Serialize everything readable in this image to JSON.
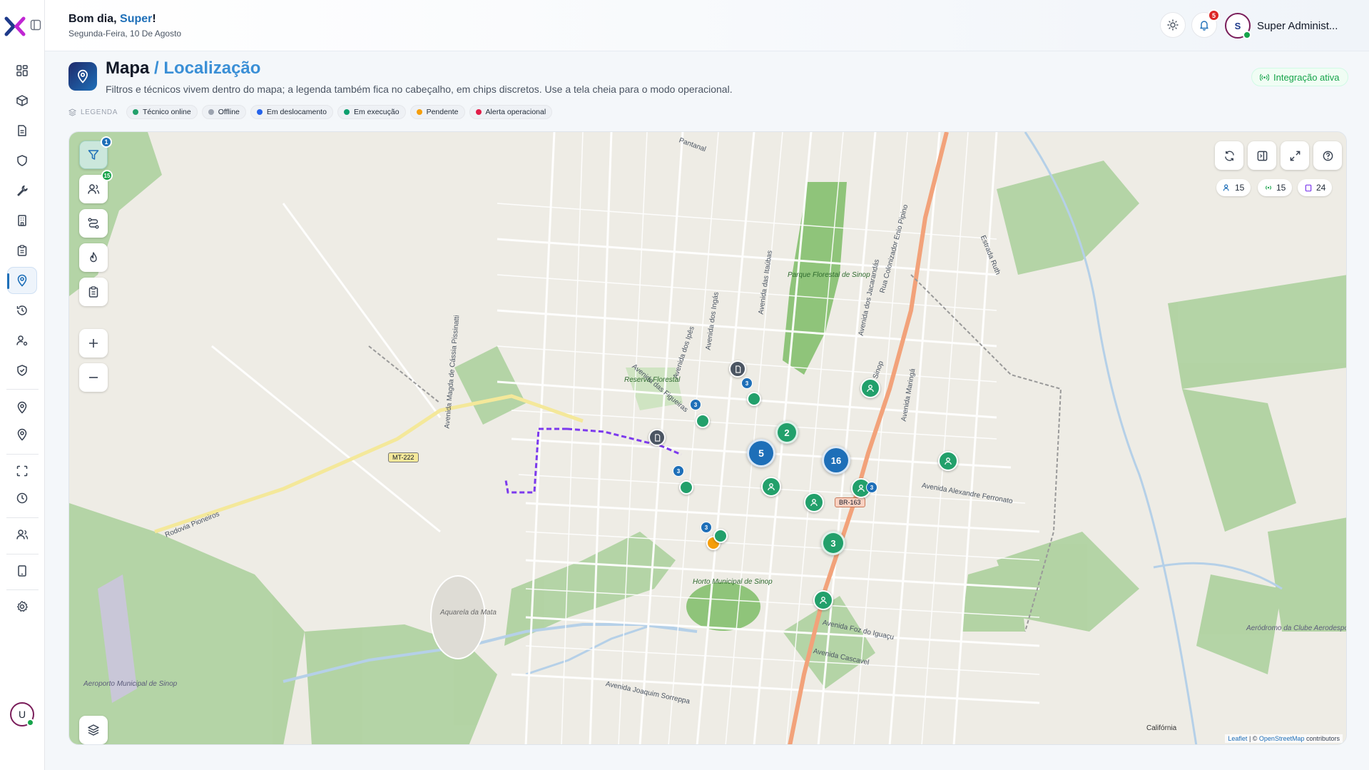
{
  "header": {
    "greeting_prefix": "Bom dia, ",
    "greeting_name": "Super",
    "greeting_suffix": "!",
    "date": "Segunda-Feira, 10 De Agosto",
    "notification_count": "5",
    "user_initial": "S",
    "user_name": "Super Administ..."
  },
  "sidebar": {
    "items": [
      "dashboard-icon",
      "box-icon",
      "document-icon",
      "shield-icon",
      "wrench-icon",
      "building-icon",
      "clipboard-icon",
      "map-pin-icon",
      "history-icon",
      "user-cog-icon",
      "shield-check-icon",
      "location-icon",
      "location-alt-icon",
      "scan-icon",
      "clock-icon",
      "users-icon",
      "tablet-icon",
      "settings-icon"
    ],
    "active": "map-pin-icon",
    "user_initial": "U"
  },
  "page": {
    "title": "Mapa",
    "subtitle": "/ Localização",
    "description": "Filtros e técnicos vivem dentro do mapa; a legenda também fica no cabeçalho, em chips discretos. Use a tela cheia para o modo operacional.",
    "integration_label": "Integração ativa"
  },
  "legend": {
    "label": "LEGENDA",
    "items": [
      {
        "label": "Técnico online",
        "color": "#22a06b"
      },
      {
        "label": "Offline",
        "color": "#9ca3af"
      },
      {
        "label": "Em deslocamento",
        "color": "#2563eb"
      },
      {
        "label": "Em execução",
        "color": "#0d9f6e"
      },
      {
        "label": "Pendente",
        "color": "#f59e0b"
      },
      {
        "label": "Alerta operacional",
        "color": "#e11d48"
      }
    ]
  },
  "map": {
    "filter_badge": "1",
    "technicians_badge": "15",
    "stats": {
      "technicians": "15",
      "online": "15",
      "orders": "24"
    },
    "clusters": [
      "5",
      "16",
      "2",
      "3"
    ],
    "mini_counts": [
      "3",
      "3",
      "3",
      "3",
      "3"
    ],
    "labels": {
      "park": "Parque Florestal de Sinop",
      "reserve": "Reserva Florestal",
      "horto": "Horto Municipal de Sinop",
      "aquarela": "Aquarela da Mata",
      "airport": "Aeroporto Municipal de Sinop",
      "aerodrome": "Aeródromo da Clube Aerodesportivo Selva",
      "california": "Califórnia",
      "mt222": "MT-222",
      "br163": "BR-163",
      "rodovia": "Rodovia Pioneiros",
      "av_joaquim": "Avenida Joaquim Sorreppa",
      "av_alexandre": "Avenida Alexandre Ferronato",
      "av_foz": "Avenida Foz do Iguaçu",
      "av_cascavel": "Avenida Cascavel",
      "av_jacarandas": "Avenida dos Jacarandás",
      "av_itaubas": "Avenida das Itaúbas",
      "av_ingas": "Avenida dos Ingás",
      "av_ipes": "Avenida dos Ipês",
      "av_figueiras": "Avenida das Figueiras",
      "av_magda": "Avenida Magda de Cássia Pissinatti",
      "av_maringa": "Avenida Maringá",
      "rua_colonizador": "Rua Colonizador Enio Pipino",
      "estrada_ruth": "Estrada Ruth",
      "pantanal": "Pantanal",
      "sinop": "Sinop"
    },
    "attribution": {
      "leaflet": "Leaflet",
      "sep": " | © ",
      "osm": "OpenStreetMap",
      "suffix": " contributors"
    }
  }
}
